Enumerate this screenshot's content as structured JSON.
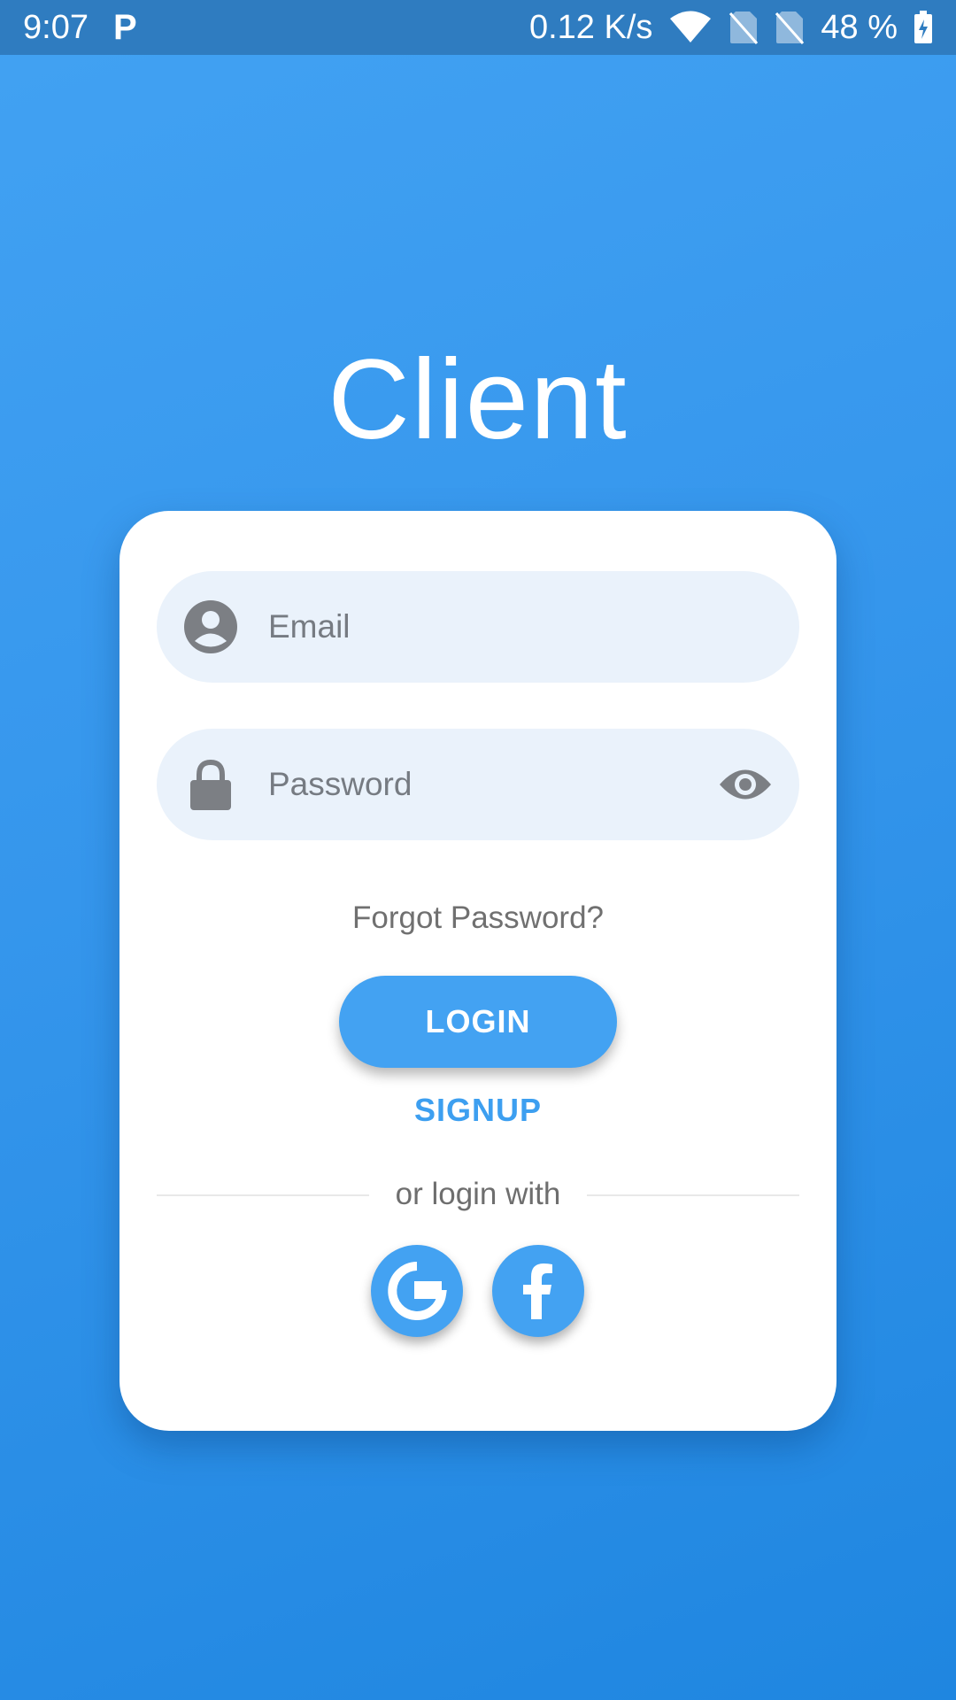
{
  "status_bar": {
    "time": "9:07",
    "app_badge": "P",
    "network_speed": "0.12 K/s",
    "battery": "48 %",
    "icons": [
      "wifi-icon",
      "no-sim-icon",
      "no-sim-icon",
      "battery-charging-icon"
    ]
  },
  "app": {
    "title": "Client"
  },
  "login_form": {
    "email": {
      "placeholder": "Email",
      "value": "",
      "icon": "account-circle-icon"
    },
    "password": {
      "placeholder": "Password",
      "value": "",
      "icon": "lock-icon",
      "toggle_icon": "eye-icon"
    },
    "forgot_password_label": "Forgot Password?",
    "login_label": "LOGIN",
    "signup_label": "SIGNUP",
    "divider_label": "or login with",
    "social": [
      {
        "name": "Google",
        "icon": "google-icon"
      },
      {
        "name": "Facebook",
        "icon": "facebook-icon"
      }
    ]
  },
  "colors": {
    "background_top": "#42a2f3",
    "background_bottom": "#1f86e0",
    "status_bar": "#2f7cc0",
    "accent": "#43a2f2",
    "field_background": "#eaf2fb",
    "placeholder_text": "#767b82"
  }
}
